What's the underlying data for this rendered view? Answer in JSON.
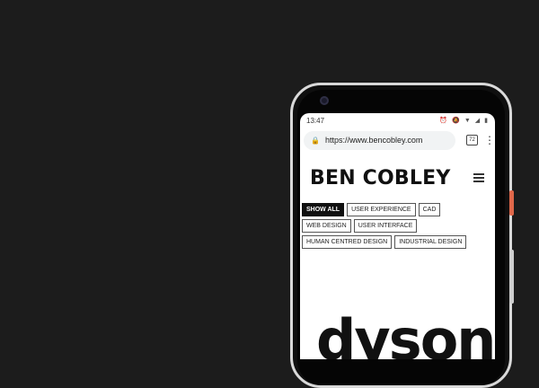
{
  "status_bar": {
    "time": "13:47",
    "icons": [
      "alarm-icon",
      "mute-icon",
      "wifi-icon",
      "signal-icon",
      "battery-icon"
    ]
  },
  "browser": {
    "url": "https://www.bencobley.com",
    "tab_count": "72",
    "lock_icon": "lock-icon",
    "menu_icon": "more-vert-icon"
  },
  "site": {
    "logo": "BEN COBLEY",
    "menu_icon": "hamburger-icon",
    "filters": [
      {
        "label": "SHOW ALL",
        "active": true
      },
      {
        "label": "USER EXPERIENCE",
        "active": false
      },
      {
        "label": "CAD",
        "active": false
      },
      {
        "label": "WEB DESIGN",
        "active": false
      },
      {
        "label": "USER INTERFACE",
        "active": false
      },
      {
        "label": "HUMAN CENTRED DESIGN",
        "active": false
      },
      {
        "label": "INDUSTRIAL DESIGN",
        "active": false
      }
    ],
    "feature_logo": "dyson"
  },
  "colors": {
    "background": "#1c1c1c",
    "phone_frame": "#d9d9d9",
    "power_button": "#e0684a",
    "active_chip": "#111111"
  }
}
